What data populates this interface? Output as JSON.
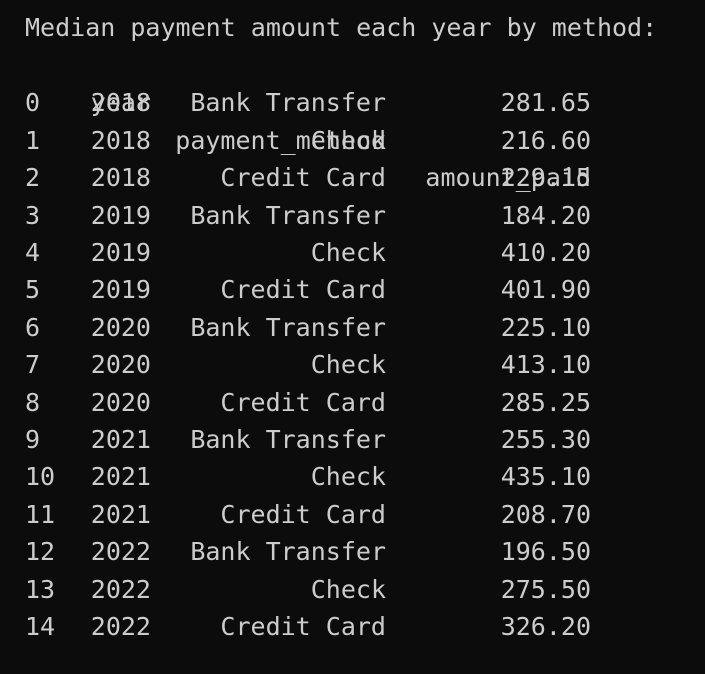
{
  "output": {
    "title": "Median payment amount each year by method:",
    "columns": [
      "year",
      "payment_method",
      "amount_paid"
    ],
    "rows": [
      {
        "index": "0",
        "year": "2018",
        "payment_method": "Bank Transfer",
        "amount_paid": "281.65"
      },
      {
        "index": "1",
        "year": "2018",
        "payment_method": "Check",
        "amount_paid": "216.60"
      },
      {
        "index": "2",
        "year": "2018",
        "payment_method": "Credit Card",
        "amount_paid": "229.15"
      },
      {
        "index": "3",
        "year": "2019",
        "payment_method": "Bank Transfer",
        "amount_paid": "184.20"
      },
      {
        "index": "4",
        "year": "2019",
        "payment_method": "Check",
        "amount_paid": "410.20"
      },
      {
        "index": "5",
        "year": "2019",
        "payment_method": "Credit Card",
        "amount_paid": "401.90"
      },
      {
        "index": "6",
        "year": "2020",
        "payment_method": "Bank Transfer",
        "amount_paid": "225.10"
      },
      {
        "index": "7",
        "year": "2020",
        "payment_method": "Check",
        "amount_paid": "413.10"
      },
      {
        "index": "8",
        "year": "2020",
        "payment_method": "Credit Card",
        "amount_paid": "285.25"
      },
      {
        "index": "9",
        "year": "2021",
        "payment_method": "Bank Transfer",
        "amount_paid": "255.30"
      },
      {
        "index": "10",
        "year": "2021",
        "payment_method": "Check",
        "amount_paid": "435.10"
      },
      {
        "index": "11",
        "year": "2021",
        "payment_method": "Credit Card",
        "amount_paid": "208.70"
      },
      {
        "index": "12",
        "year": "2022",
        "payment_method": "Bank Transfer",
        "amount_paid": "196.50"
      },
      {
        "index": "13",
        "year": "2022",
        "payment_method": "Check",
        "amount_paid": "275.50"
      },
      {
        "index": "14",
        "year": "2022",
        "payment_method": "Credit Card",
        "amount_paid": "326.20"
      }
    ]
  },
  "colors": {
    "background": "#0c0c0c",
    "text": "#cccccc"
  }
}
